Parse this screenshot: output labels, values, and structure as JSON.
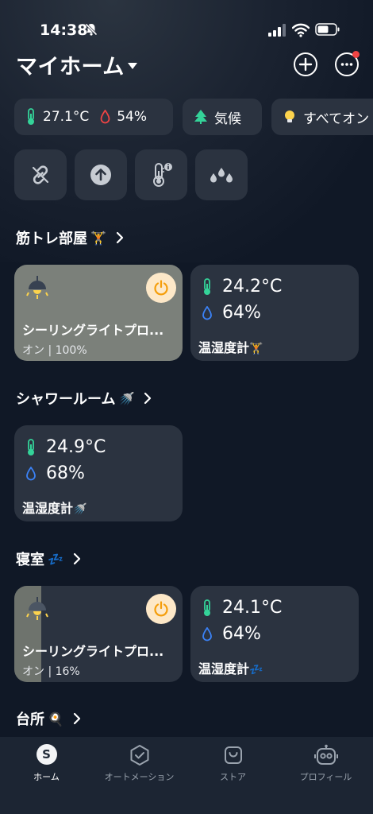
{
  "status_bar": {
    "time": "14:38"
  },
  "header": {
    "title": "マイホーム"
  },
  "chips": [
    {
      "temp": "27.1°C",
      "humidity": "54%"
    },
    {
      "label": "気候"
    },
    {
      "label": "すべてオン"
    }
  ],
  "sections": [
    {
      "title": "筋トレ部屋",
      "title_emoji": "🏋️",
      "light": {
        "name": "シーリングライトプロ...",
        "status": "オン | 100%",
        "brightness": 100
      },
      "sensor": {
        "temp": "24.2°C",
        "humidity": "64%",
        "label": "温湿度計",
        "label_emoji": "🏋️"
      }
    },
    {
      "title": "シャワールーム",
      "title_emoji": "🚿",
      "sensor": {
        "temp": "24.9°C",
        "humidity": "68%",
        "label": "温湿度計",
        "label_emoji": "🚿"
      }
    },
    {
      "title": "寝室",
      "title_emoji": "💤",
      "light": {
        "name": "シーリングライトプロ...",
        "status": "オン | 16%",
        "brightness": 16
      },
      "sensor": {
        "temp": "24.1°C",
        "humidity": "64%",
        "label": "温湿度計",
        "label_emoji": "💤"
      }
    },
    {
      "title": "台所",
      "title_emoji": "🍳"
    }
  ],
  "tabbar": {
    "items": [
      {
        "label": "ホーム",
        "icon": "home-s-icon",
        "active": true,
        "glyph": "S"
      },
      {
        "label": "オートメーション",
        "icon": "automation-check-icon",
        "active": false
      },
      {
        "label": "ストア",
        "icon": "store-bag-icon",
        "active": false
      },
      {
        "label": "プロフィール",
        "icon": "profile-robot-icon",
        "active": false
      }
    ]
  },
  "colors": {
    "background": "#101826",
    "card": "#2b3340",
    "thermometer": "#34d399",
    "water_drop": "#3b82f6",
    "chip_drop": "#ef4444",
    "power_bg": "#fde8c8",
    "power_icon": "#f59e0b"
  }
}
